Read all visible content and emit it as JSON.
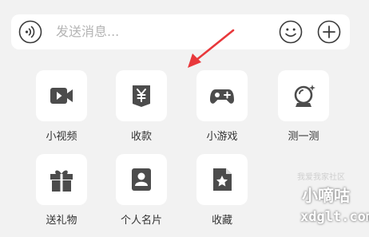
{
  "input_bar": {
    "placeholder": "发送消息...",
    "voice_icon": "voice-wave-icon",
    "emoji_icon": "smiley-face-icon",
    "plus_icon": "plus-circle-icon"
  },
  "panel": {
    "items": [
      {
        "label": "小视频",
        "icon": "video-camera-icon"
      },
      {
        "label": "收款",
        "icon": "yuan-receive-icon"
      },
      {
        "label": "小游戏",
        "icon": "gamepad-icon"
      },
      {
        "label": "测一测",
        "icon": "crystal-ball-icon"
      },
      {
        "label": "送礼物",
        "icon": "gift-icon"
      },
      {
        "label": "个人名片",
        "icon": "contact-card-icon"
      },
      {
        "label": "收藏",
        "icon": "star-document-icon"
      }
    ]
  },
  "annotation": {
    "arrow_color": "#e8383b"
  },
  "watermark": {
    "top": "我爱我家社区",
    "main": "小嘀咕",
    "url": "xdglt.com"
  },
  "colors": {
    "icon": "#4c4c4c",
    "background": "#f2f2f2",
    "tile": "#ffffff"
  }
}
